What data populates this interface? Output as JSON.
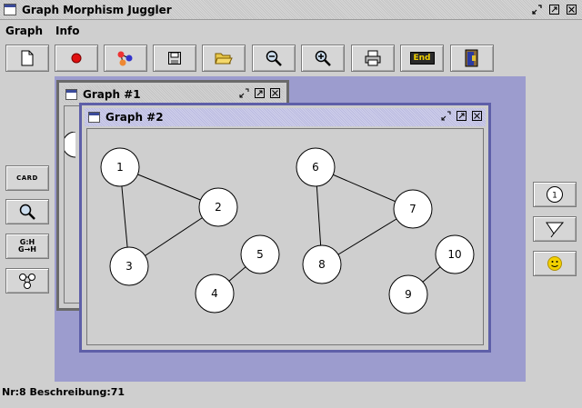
{
  "window": {
    "title": "Graph Morphism Juggler"
  },
  "menu": [
    {
      "label": "Graph"
    },
    {
      "label": "Info"
    }
  ],
  "toolbar": [
    {
      "name": "new-document-icon"
    },
    {
      "name": "record-dot-icon"
    },
    {
      "name": "graph-nodes-icon"
    },
    {
      "name": "save-floppy-icon"
    },
    {
      "name": "open-folder-icon"
    },
    {
      "name": "zoom-out-icon"
    },
    {
      "name": "zoom-in-icon"
    },
    {
      "name": "print-icon"
    },
    {
      "name": "end-label-icon",
      "label": "End"
    },
    {
      "name": "exit-door-icon"
    }
  ],
  "left_tools": [
    {
      "name": "card-icon",
      "label": "CARD"
    },
    {
      "name": "search-magnifier-icon"
    },
    {
      "name": "morphism-mapping-icon",
      "label": "G:H G→H"
    },
    {
      "name": "node-graph-icon"
    }
  ],
  "right_tools": [
    {
      "name": "add-node-icon",
      "label": "1"
    },
    {
      "name": "edge-drawing-icon"
    },
    {
      "name": "smiley-icon"
    }
  ],
  "frames": [
    {
      "title": "Graph #1"
    },
    {
      "title": "Graph #2"
    }
  ],
  "graph2": {
    "nodes": [
      {
        "id": "1"
      },
      {
        "id": "2"
      },
      {
        "id": "3"
      },
      {
        "id": "4"
      },
      {
        "id": "5"
      },
      {
        "id": "6"
      },
      {
        "id": "7"
      },
      {
        "id": "8"
      },
      {
        "id": "9"
      },
      {
        "id": "10"
      }
    ],
    "edges": [
      [
        "1",
        "2"
      ],
      [
        "1",
        "3"
      ],
      [
        "2",
        "3"
      ],
      [
        "4",
        "5"
      ],
      [
        "6",
        "7"
      ],
      [
        "6",
        "8"
      ],
      [
        "7",
        "8"
      ],
      [
        "9",
        "10"
      ]
    ]
  },
  "status": {
    "text": "Nr:8 Beschreibung:71"
  },
  "colors": {
    "desktop": "#9c9cce",
    "active_frame_border": "#5e5fa8",
    "inactive_frame_border": "#6a6a6a"
  }
}
